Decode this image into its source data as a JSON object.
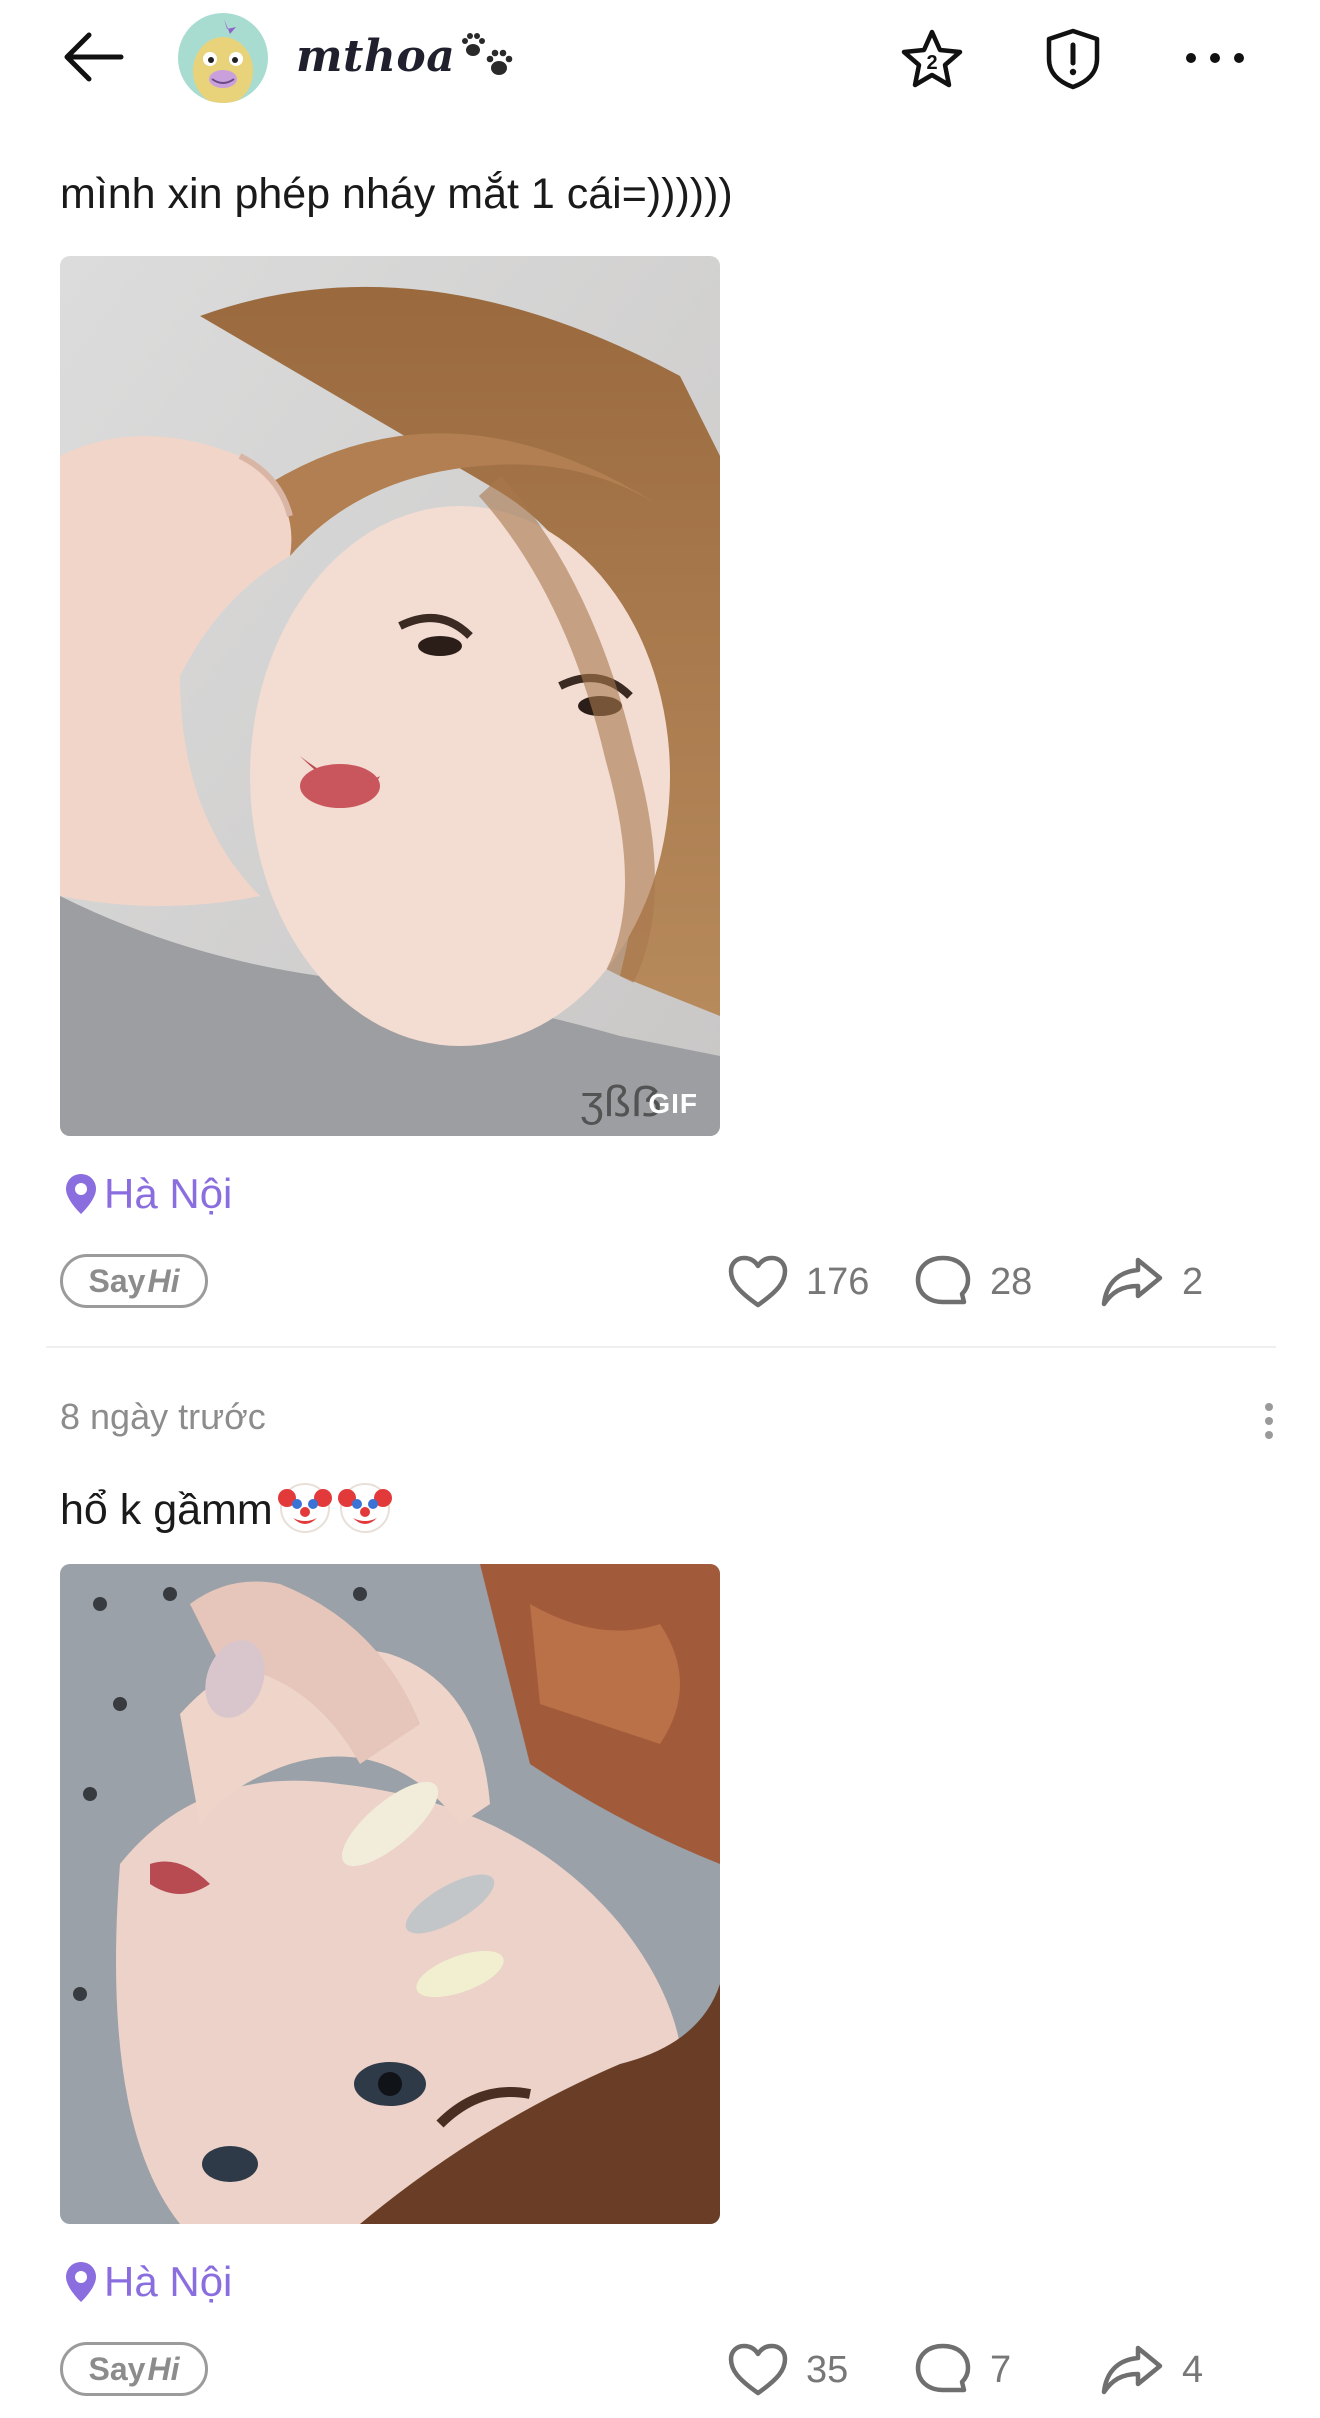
{
  "header": {
    "username": "mthoa",
    "star_count": "2"
  },
  "posts": [
    {
      "text": "mình xin phép nháy mắt 1 cái=))))))",
      "image_badge": "GIF",
      "location": "Hà Nội",
      "sayhi": {
        "say": "Say",
        "hi": "Hi"
      },
      "likes": "176",
      "comments": "28",
      "shares": "2"
    },
    {
      "timestamp": "8 ngày trước",
      "text": "hổ k gầmm",
      "emojis": [
        "clown-face",
        "clown-face"
      ],
      "location": "Hà Nội",
      "sayhi": {
        "say": "Say",
        "hi": "Hi"
      },
      "likes": "35",
      "comments": "7",
      "shares": "4"
    }
  ],
  "colors": {
    "accent": "#8a6ee0",
    "text": "#1a1a1a",
    "muted": "#8c8c8c",
    "divider": "#efefef"
  }
}
